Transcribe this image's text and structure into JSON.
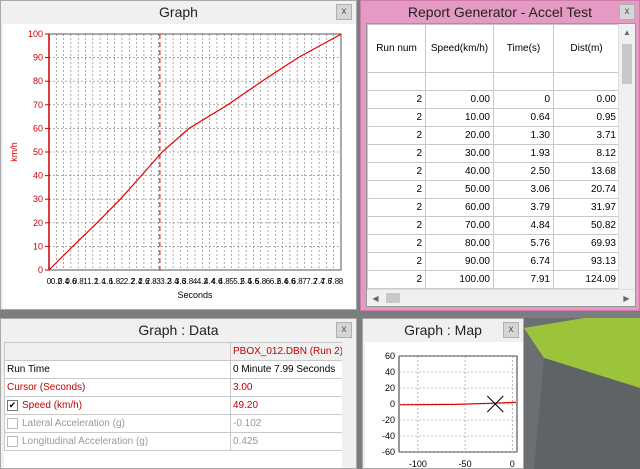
{
  "graph_panel": {
    "title": "Graph",
    "close": "x",
    "chart_data": {
      "type": "line",
      "ylabel": "km/h",
      "xlabel": "Seconds",
      "ylim": [
        0,
        100
      ],
      "yticks": [
        0,
        10,
        20,
        30,
        40,
        50,
        60,
        70,
        80,
        90,
        100
      ],
      "xlim": [
        0,
        7.9
      ],
      "cursor_x": 3.0,
      "grid": true,
      "series": [
        {
          "color": "#e00000",
          "x": [
            0,
            0.64,
            1.3,
            1.93,
            2.5,
            3.06,
            3.79,
            4.84,
            5.76,
            6.74,
            7.91
          ],
          "y": [
            0,
            10,
            20,
            30,
            40,
            50,
            60,
            70,
            80,
            90,
            100
          ]
        }
      ]
    }
  },
  "report_panel": {
    "title": "Report Generator - Accel Test",
    "close": "x",
    "columns": [
      "Run num",
      "Speed(km/h)",
      "Time(s)",
      "Dist(m)"
    ],
    "rows": [
      [
        "",
        "",
        "",
        ""
      ],
      [
        "2",
        "0.00",
        "0",
        "0.00"
      ],
      [
        "2",
        "10.00",
        "0.64",
        "0.95"
      ],
      [
        "2",
        "20.00",
        "1.30",
        "3.71"
      ],
      [
        "2",
        "30.00",
        "1.93",
        "8.12"
      ],
      [
        "2",
        "40.00",
        "2.50",
        "13.68"
      ],
      [
        "2",
        "50.00",
        "3.06",
        "20.74"
      ],
      [
        "2",
        "60.00",
        "3.79",
        "31.97"
      ],
      [
        "2",
        "70.00",
        "4.84",
        "50.82"
      ],
      [
        "2",
        "80.00",
        "5.76",
        "69.93"
      ],
      [
        "2",
        "90.00",
        "6.74",
        "93.13"
      ],
      [
        "2",
        "100.00",
        "7.91",
        "124.09"
      ]
    ]
  },
  "data_panel": {
    "title": "Graph : Data",
    "close": "x",
    "file_header": "PBOX_012.DBN (Run 2)",
    "rows": [
      {
        "label": "Run Time",
        "value": "0 Minute 7.99 Seconds",
        "style": "normal",
        "checkbox": false
      },
      {
        "label": "Cursor (Seconds)",
        "value": "3.00",
        "style": "red",
        "checkbox": false
      },
      {
        "label": "Speed (km/h)",
        "value": "49.20",
        "style": "red",
        "checkbox": true,
        "checked": true
      },
      {
        "label": "Lateral Acceleration (g)",
        "value": "-0.102",
        "style": "gray",
        "checkbox": true,
        "checked": false
      },
      {
        "label": "Longitudinal Acceleration (g)",
        "value": "0.425",
        "style": "gray",
        "checkbox": true,
        "checked": false
      }
    ]
  },
  "map_panel": {
    "title": "Graph : Map",
    "close": "x",
    "yticks": [
      60,
      40,
      20,
      0,
      -20,
      -40,
      -60
    ],
    "xticks": [
      -100,
      -50,
      0
    ]
  }
}
